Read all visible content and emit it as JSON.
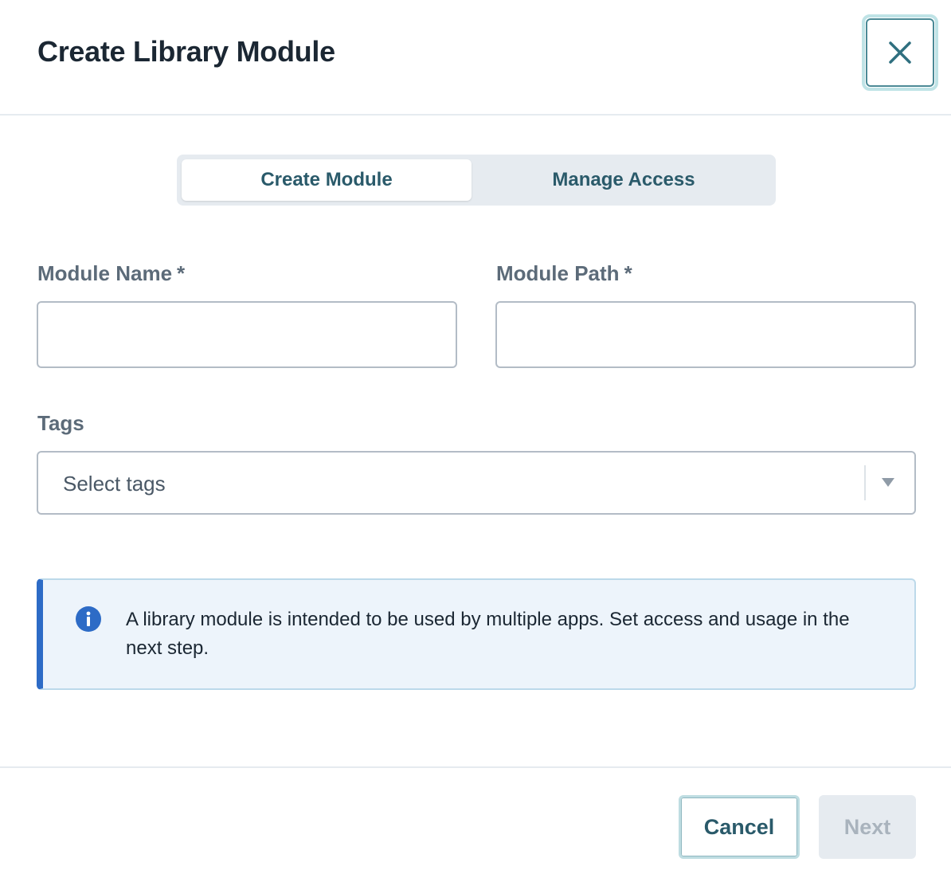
{
  "dialog": {
    "title": "Create Library Module",
    "close_icon": "close-icon"
  },
  "tabs": [
    {
      "label": "Create Module",
      "active": true
    },
    {
      "label": "Manage Access",
      "active": false
    }
  ],
  "form": {
    "module_name": {
      "label": "Module Name",
      "required_marker": "*",
      "value": ""
    },
    "module_path": {
      "label": "Module Path",
      "required_marker": "*",
      "value": ""
    },
    "tags": {
      "label": "Tags",
      "placeholder": "Select tags",
      "caret_icon": "caret-down-icon"
    }
  },
  "banner": {
    "icon": "info-icon",
    "message": "A library module is intended to be used by multiple apps. Set access and usage in the next step."
  },
  "footer": {
    "cancel_label": "Cancel",
    "next_label": "Next"
  },
  "colors": {
    "primary_text": "#1b2733",
    "accent_teal": "#2a5a6a",
    "info_blue": "#2d6bc6",
    "banner_bg": "#edf4fb"
  }
}
